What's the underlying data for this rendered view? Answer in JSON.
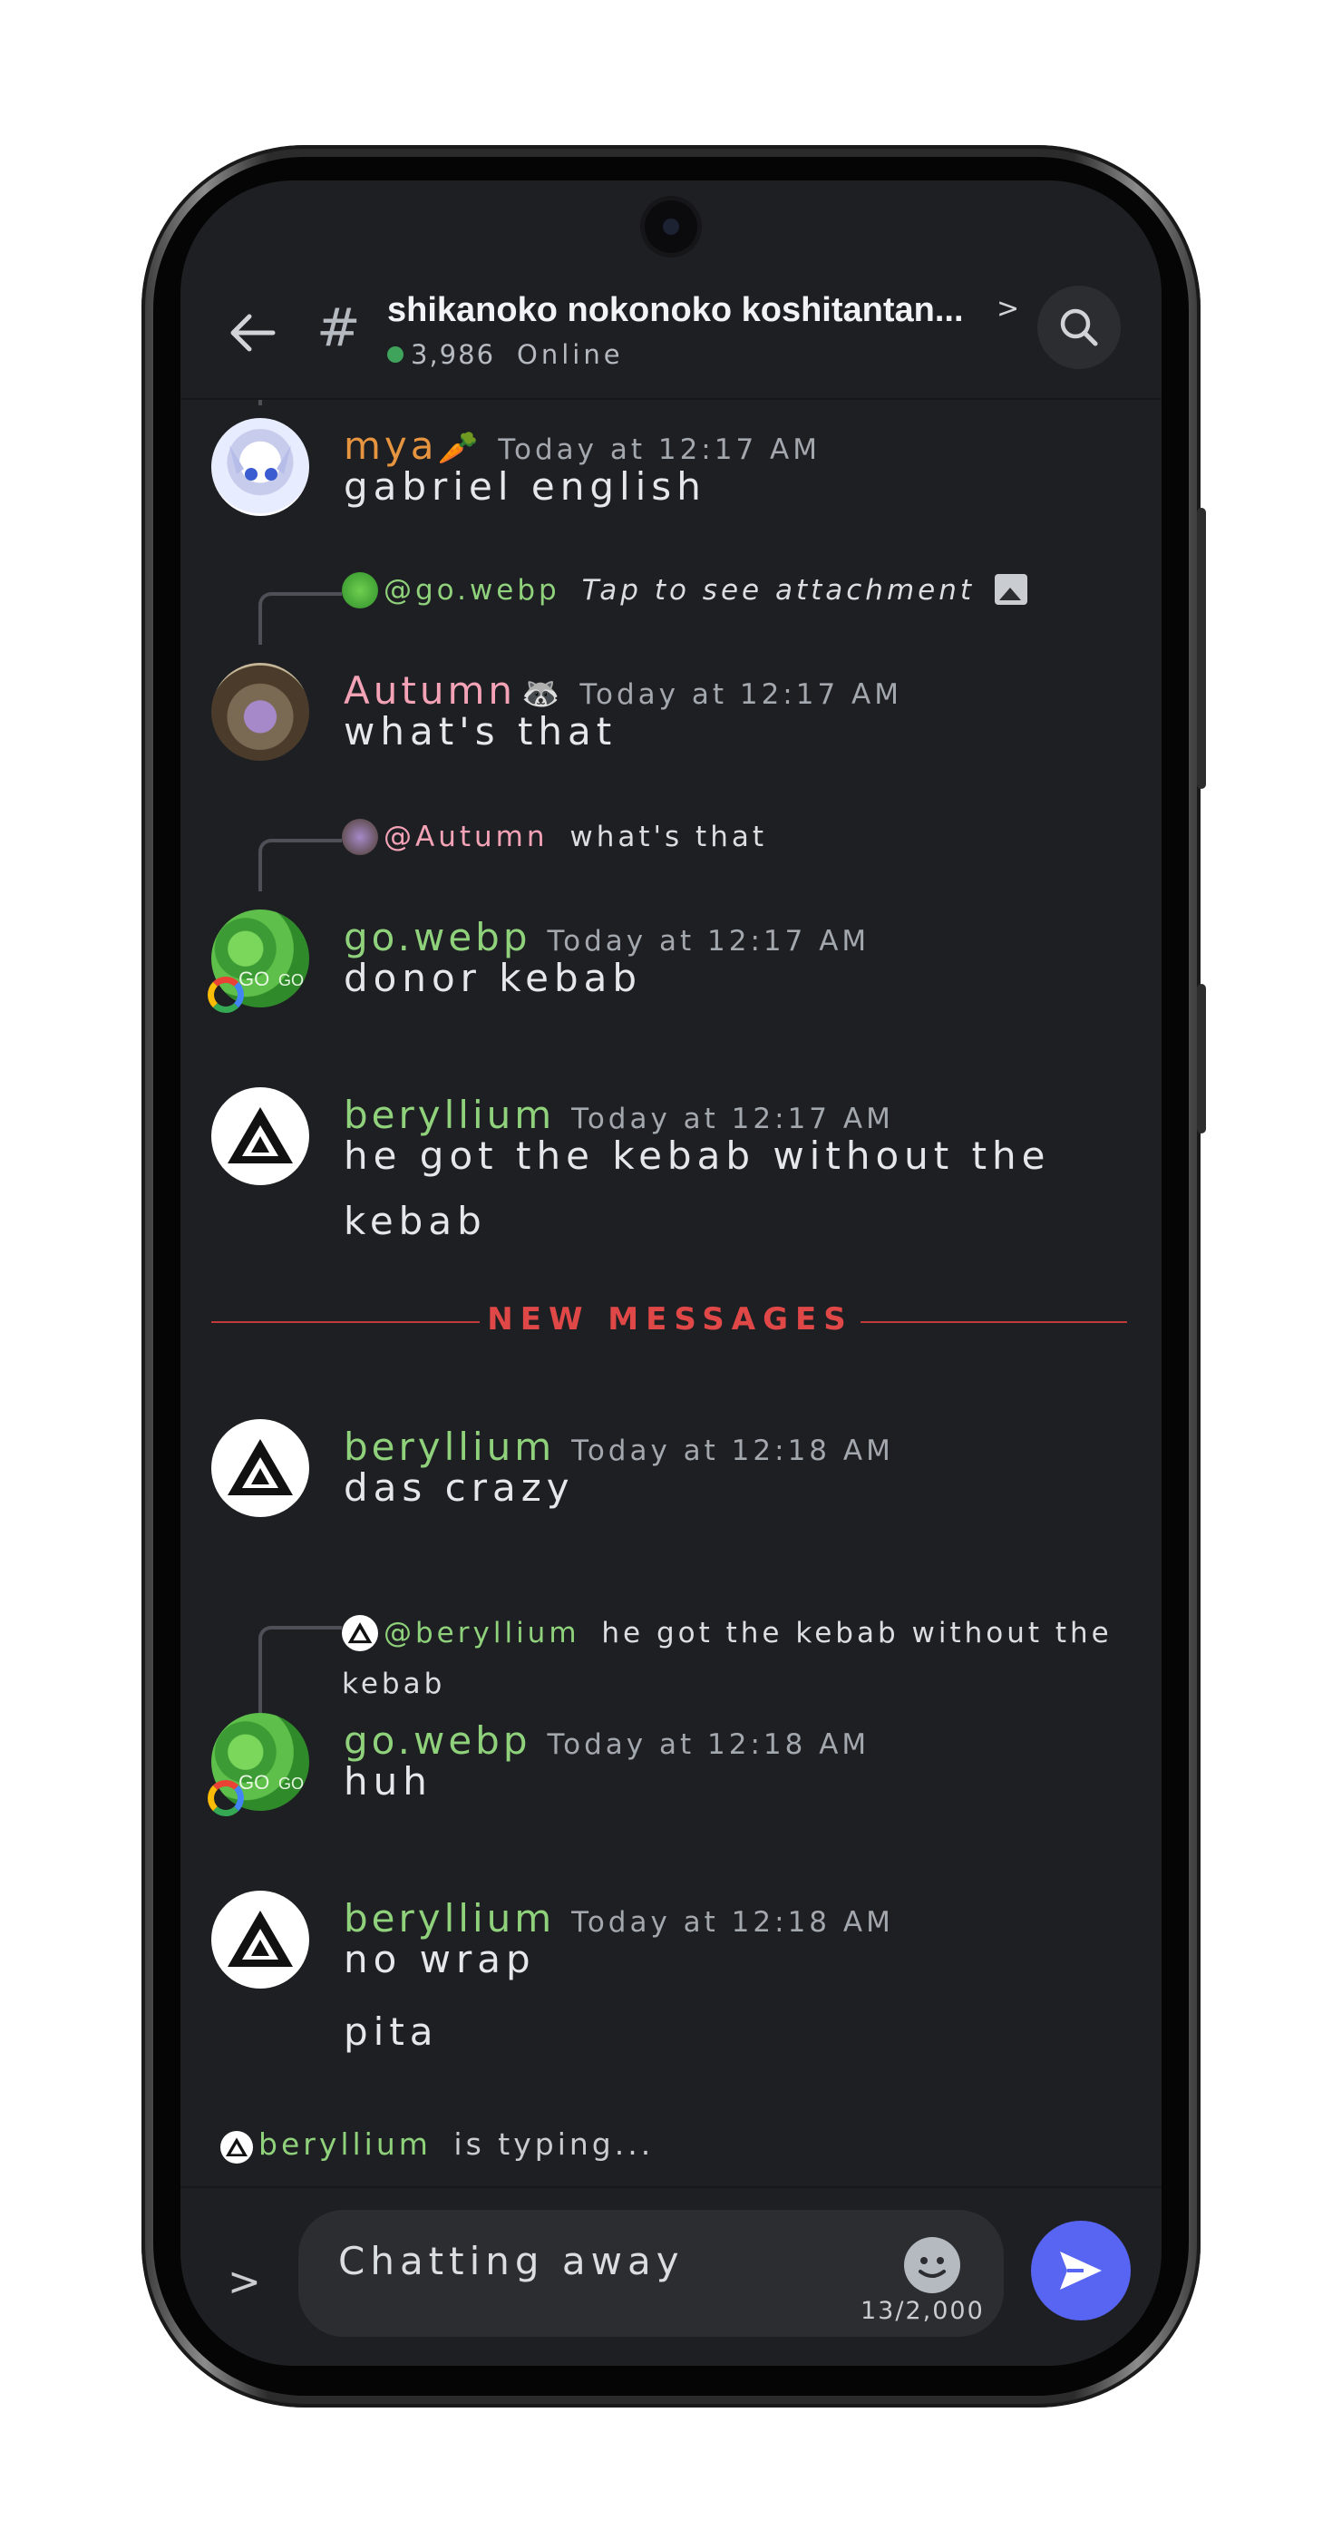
{
  "channel": {
    "name": "shikanoko nokonoko koshitantan...",
    "online_count": "3,986",
    "online_label": "Online"
  },
  "messages": [
    {
      "author": "mya",
      "author_emoji": "🥕",
      "time": "Today at 12:17 AM",
      "text": "gabriel english"
    },
    {
      "reply_to": "@go.webp",
      "reply_text": "Tap to see attachment",
      "author": "Autumn",
      "author_emoji": "🦝",
      "time": "Today at 12:17 AM",
      "text": "what's that"
    },
    {
      "reply_to": "@Autumn",
      "reply_text": "what's that",
      "author": "go.webp",
      "time": "Today at 12:17 AM",
      "text": "donor kebab"
    },
    {
      "author": "beryllium",
      "time": "Today at 12:17 AM",
      "text_lines": [
        "he got the kebab without the",
        "kebab"
      ]
    },
    {
      "author": "beryllium",
      "time": "Today at 12:18 AM",
      "text": "das crazy"
    },
    {
      "reply_to": "@beryllium",
      "reply_text_lines": [
        "he got the kebab without the",
        "kebab"
      ],
      "author": "go.webp",
      "time": "Today at 12:18 AM",
      "text": "huh"
    },
    {
      "author": "beryllium",
      "time": "Today at 12:18 AM",
      "text": "no wrap",
      "text2": "pita"
    }
  ],
  "new_messages_label": "NEW MESSAGES",
  "typing": {
    "user": "beryllium",
    "suffix": "is typing..."
  },
  "composer": {
    "value": "Chatting away",
    "counter": "13/2,000"
  },
  "colors": {
    "accent": "#5865f2",
    "online": "#3fa35c",
    "new_messages": "#e04848",
    "mya": "#e69440",
    "autumn": "#f4a3b7",
    "green_names": "#8fd27b"
  },
  "icons": [
    "back-arrow-icon",
    "hash-icon",
    "chevron-right-icon",
    "search-icon",
    "attachment-image-icon",
    "expand-chevron-icon",
    "emoji-icon",
    "send-icon"
  ]
}
